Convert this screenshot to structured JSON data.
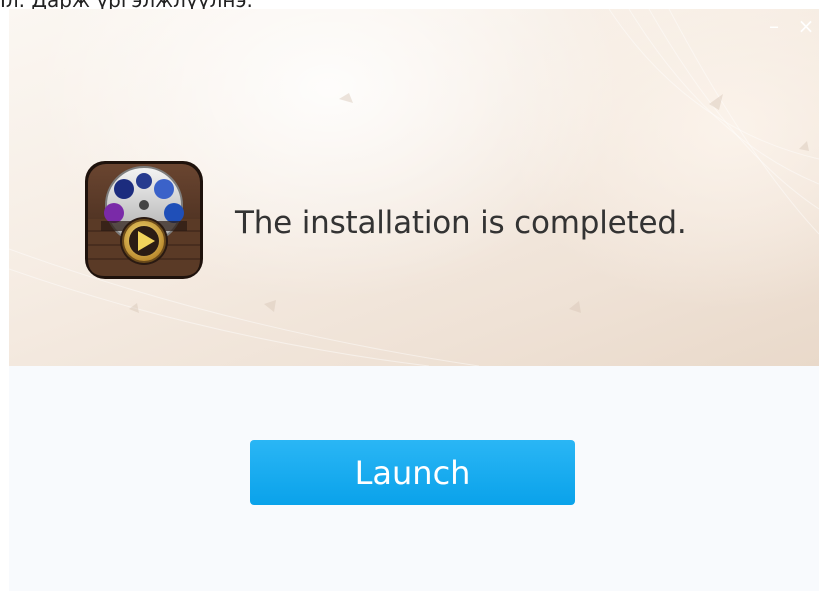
{
  "caption": "Iл. Дарж үргэлжлүүлнэ.",
  "window": {
    "controls": {
      "minimize": "–",
      "close": "×"
    },
    "app_icon": "movie-reel-play-icon",
    "status_text": "The installation is completed.",
    "launch_label": "Launch"
  },
  "colors": {
    "accent": "#1aaaf0",
    "banner": "#f4e9df",
    "body_bg": "#f8fafd",
    "text": "#333333"
  }
}
